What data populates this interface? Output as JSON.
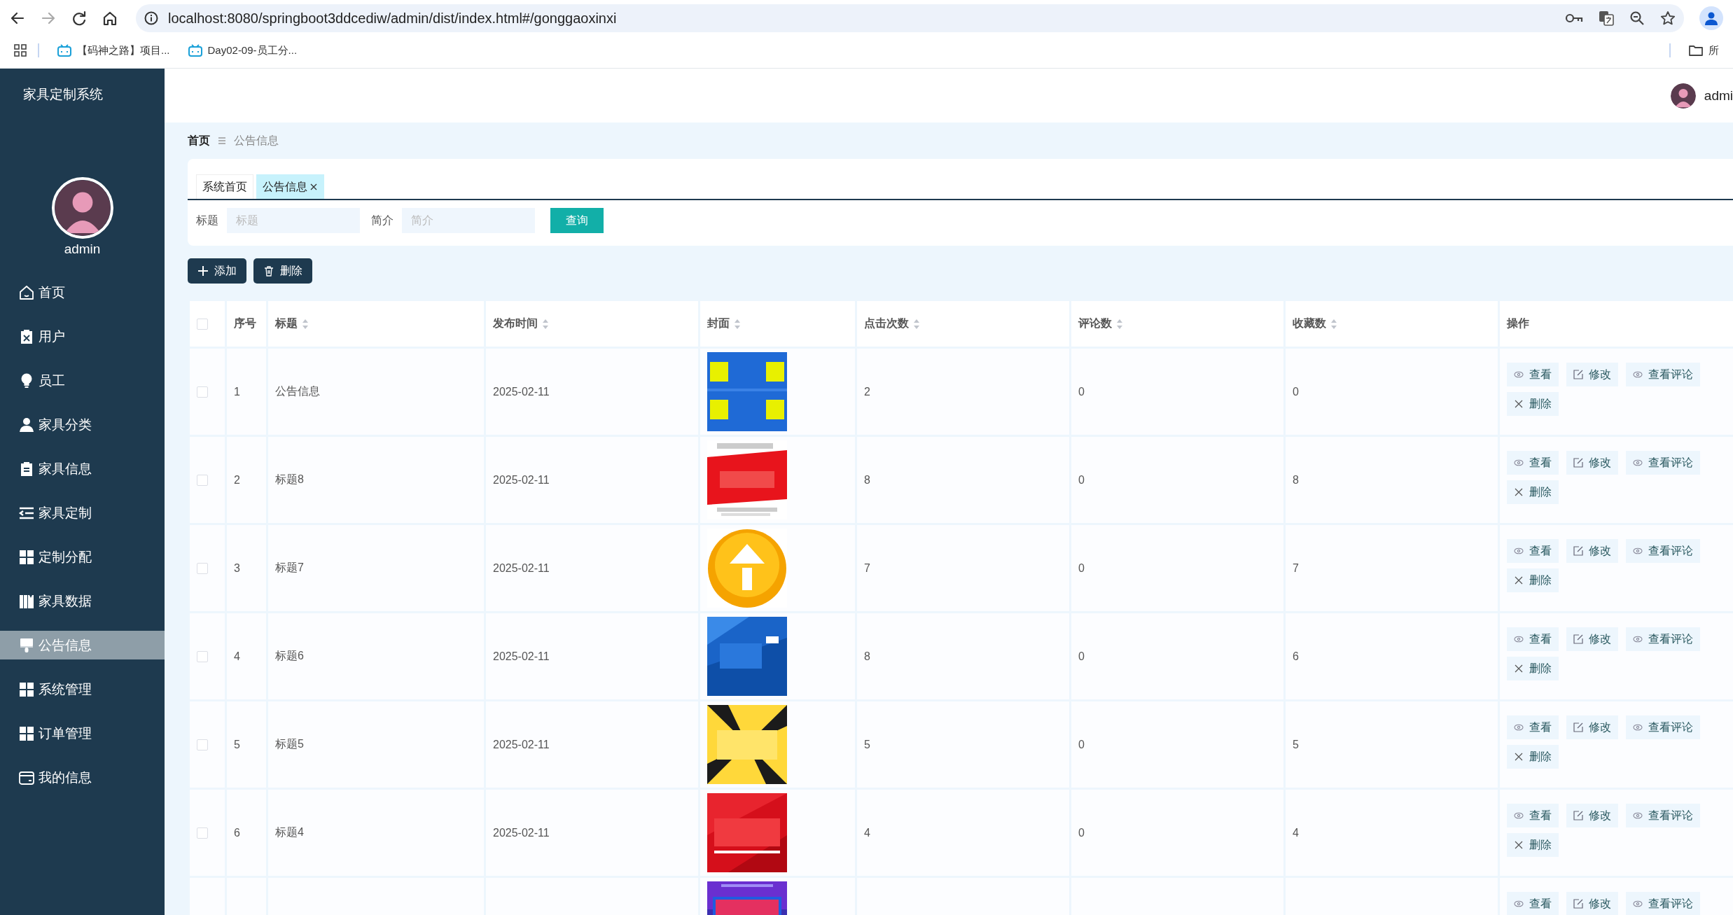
{
  "browser": {
    "url": "localhost:8080/springboot3ddcediw/admin/dist/index.html#/gonggaoxinxi",
    "bookmarks": [
      {
        "label": "【码神之路】项目..."
      },
      {
        "label": "Day02-09-员工分..."
      }
    ],
    "bookmark_folder": "所"
  },
  "sidebar": {
    "title": "家具定制系统",
    "user": "admin",
    "items": [
      {
        "label": "首页",
        "kind": "home",
        "selected": false
      },
      {
        "label": "用户",
        "kind": "clipboard-x",
        "selected": false
      },
      {
        "label": "员工",
        "kind": "bulb",
        "selected": false
      },
      {
        "label": "家具分类",
        "kind": "person",
        "selected": false
      },
      {
        "label": "家具信息",
        "kind": "clipboard",
        "selected": false
      },
      {
        "label": "家具定制",
        "kind": "indent",
        "selected": false
      },
      {
        "label": "定制分配",
        "kind": "grid",
        "selected": false
      },
      {
        "label": "家具数据",
        "kind": "books",
        "selected": false
      },
      {
        "label": "公告信息",
        "kind": "brush",
        "selected": true
      },
      {
        "label": "系统管理",
        "kind": "grid",
        "selected": false
      },
      {
        "label": "订单管理",
        "kind": "grid",
        "selected": false
      },
      {
        "label": "我的信息",
        "kind": "card",
        "selected": false
      }
    ]
  },
  "header": {
    "user": "admi"
  },
  "breadcrumb": [
    "首页",
    "公告信息"
  ],
  "tabs": [
    {
      "label": "系统首页",
      "selected": false,
      "closable": false
    },
    {
      "label": "公告信息",
      "selected": true,
      "closable": true
    }
  ],
  "search": {
    "fields": [
      {
        "label": "标题",
        "placeholder": "标题"
      },
      {
        "label": "简介",
        "placeholder": "简介"
      }
    ],
    "button": "查询"
  },
  "toolbar": [
    {
      "label": "添加",
      "kind": "add"
    },
    {
      "label": "删除",
      "kind": "delete"
    }
  ],
  "table": {
    "header_checked": false,
    "columns": [
      {
        "label": "序号",
        "sortable": false
      },
      {
        "label": "标题",
        "sortable": true
      },
      {
        "label": "发布时间",
        "sortable": true
      },
      {
        "label": "封面",
        "sortable": true
      },
      {
        "label": "点击次数",
        "sortable": true
      },
      {
        "label": "评论数",
        "sortable": true
      },
      {
        "label": "收藏数",
        "sortable": true
      },
      {
        "label": "操作",
        "sortable": false
      }
    ],
    "rows": [
      {
        "checked": false,
        "cells": [
          "1",
          "公告信息",
          "2025-02-11",
          "2",
          "0",
          "0"
        ],
        "cover": {
          "kind": "picture"
        },
        "actions": [
          {
            "label": "查看",
            "kind": "view"
          },
          {
            "label": "修改",
            "kind": "edit"
          },
          {
            "label": "查看评论",
            "kind": "view"
          },
          {
            "label": "删除",
            "kind": "delete"
          }
        ]
      },
      {
        "checked": false,
        "cells": [
          "2",
          "标题8",
          "2025-02-11",
          "8",
          "0",
          "8"
        ],
        "cover": {
          "kind": "picture"
        },
        "actions": [
          {
            "label": "查看",
            "kind": "view"
          },
          {
            "label": "修改",
            "kind": "edit"
          },
          {
            "label": "查看评论",
            "kind": "view"
          },
          {
            "label": "删除",
            "kind": "delete"
          }
        ]
      },
      {
        "checked": false,
        "cells": [
          "3",
          "标题7",
          "2025-02-11",
          "7",
          "0",
          "7"
        ],
        "cover": {
          "kind": "picture"
        },
        "actions": [
          {
            "label": "查看",
            "kind": "view"
          },
          {
            "label": "修改",
            "kind": "edit"
          },
          {
            "label": "查看评论",
            "kind": "view"
          },
          {
            "label": "删除",
            "kind": "delete"
          }
        ]
      },
      {
        "checked": false,
        "cells": [
          "4",
          "标题6",
          "2025-02-11",
          "8",
          "0",
          "6"
        ],
        "cover": {
          "kind": "picture"
        },
        "actions": [
          {
            "label": "查看",
            "kind": "view"
          },
          {
            "label": "修改",
            "kind": "edit"
          },
          {
            "label": "查看评论",
            "kind": "view"
          },
          {
            "label": "删除",
            "kind": "delete"
          }
        ]
      },
      {
        "checked": false,
        "cells": [
          "5",
          "标题5",
          "2025-02-11",
          "5",
          "0",
          "5"
        ],
        "cover": {
          "kind": "picture"
        },
        "actions": [
          {
            "label": "查看",
            "kind": "view"
          },
          {
            "label": "修改",
            "kind": "edit"
          },
          {
            "label": "查看评论",
            "kind": "view"
          },
          {
            "label": "删除",
            "kind": "delete"
          }
        ]
      },
      {
        "checked": false,
        "cells": [
          "6",
          "标题4",
          "2025-02-11",
          "4",
          "0",
          "4"
        ],
        "cover": {
          "kind": "picture"
        },
        "actions": [
          {
            "label": "查看",
            "kind": "view"
          },
          {
            "label": "修改",
            "kind": "edit"
          },
          {
            "label": "查看评论",
            "kind": "view"
          },
          {
            "label": "删除",
            "kind": "delete"
          }
        ]
      },
      {
        "cover": {
          "kind": "picture"
        },
        "actions": [
          {
            "label": "查看",
            "kind": "view"
          },
          {
            "label": "修改",
            "kind": "edit"
          },
          {
            "label": "查看评论",
            "kind": "view"
          }
        ]
      }
    ]
  }
}
